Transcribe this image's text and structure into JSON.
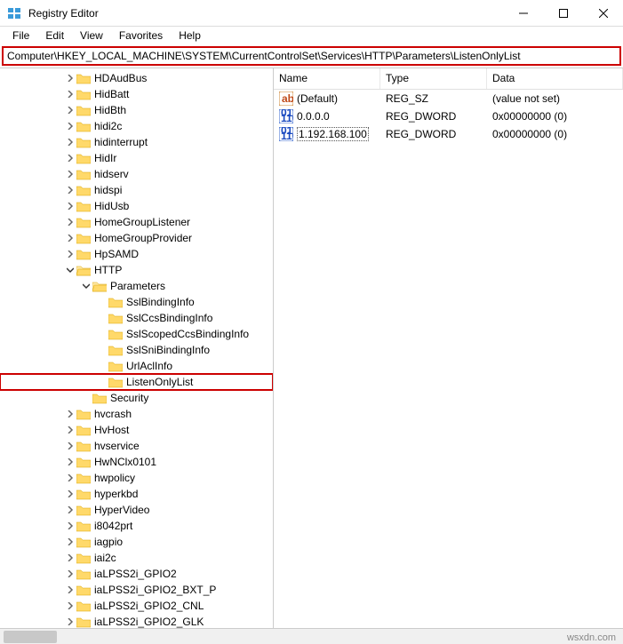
{
  "window": {
    "title": "Registry Editor"
  },
  "menu": {
    "file": "File",
    "edit": "Edit",
    "view": "View",
    "favorites": "Favorites",
    "help": "Help"
  },
  "address": "Computer\\HKEY_LOCAL_MACHINE\\SYSTEM\\CurrentControlSet\\Services\\HTTP\\Parameters\\ListenOnlyList",
  "tree": [
    {
      "indent": 4,
      "expander": "closed",
      "label": "HDAudBus"
    },
    {
      "indent": 4,
      "expander": "closed",
      "label": "HidBatt"
    },
    {
      "indent": 4,
      "expander": "closed",
      "label": "HidBth"
    },
    {
      "indent": 4,
      "expander": "closed",
      "label": "hidi2c"
    },
    {
      "indent": 4,
      "expander": "closed",
      "label": "hidinterrupt"
    },
    {
      "indent": 4,
      "expander": "closed",
      "label": "HidIr"
    },
    {
      "indent": 4,
      "expander": "closed",
      "label": "hidserv"
    },
    {
      "indent": 4,
      "expander": "closed",
      "label": "hidspi"
    },
    {
      "indent": 4,
      "expander": "closed",
      "label": "HidUsb"
    },
    {
      "indent": 4,
      "expander": "closed",
      "label": "HomeGroupListener"
    },
    {
      "indent": 4,
      "expander": "closed",
      "label": "HomeGroupProvider"
    },
    {
      "indent": 4,
      "expander": "closed",
      "label": "HpSAMD"
    },
    {
      "indent": 4,
      "expander": "open",
      "label": "HTTP"
    },
    {
      "indent": 5,
      "expander": "open",
      "label": "Parameters"
    },
    {
      "indent": 6,
      "expander": "none",
      "label": "SslBindingInfo"
    },
    {
      "indent": 6,
      "expander": "none",
      "label": "SslCcsBindingInfo"
    },
    {
      "indent": 6,
      "expander": "none",
      "label": "SslScopedCcsBindingInfo"
    },
    {
      "indent": 6,
      "expander": "none",
      "label": "SslSniBindingInfo"
    },
    {
      "indent": 6,
      "expander": "none",
      "label": "UrlAclInfo"
    },
    {
      "indent": 6,
      "expander": "none",
      "label": "ListenOnlyList",
      "highlight": true
    },
    {
      "indent": 5,
      "expander": "none",
      "label": "Security"
    },
    {
      "indent": 4,
      "expander": "closed",
      "label": "hvcrash"
    },
    {
      "indent": 4,
      "expander": "closed",
      "label": "HvHost"
    },
    {
      "indent": 4,
      "expander": "closed",
      "label": "hvservice"
    },
    {
      "indent": 4,
      "expander": "closed",
      "label": "HwNClx0101"
    },
    {
      "indent": 4,
      "expander": "closed",
      "label": "hwpolicy"
    },
    {
      "indent": 4,
      "expander": "closed",
      "label": "hyperkbd"
    },
    {
      "indent": 4,
      "expander": "closed",
      "label": "HyperVideo"
    },
    {
      "indent": 4,
      "expander": "closed",
      "label": "i8042prt"
    },
    {
      "indent": 4,
      "expander": "closed",
      "label": "iagpio"
    },
    {
      "indent": 4,
      "expander": "closed",
      "label": "iai2c"
    },
    {
      "indent": 4,
      "expander": "closed",
      "label": "iaLPSS2i_GPIO2"
    },
    {
      "indent": 4,
      "expander": "closed",
      "label": "iaLPSS2i_GPIO2_BXT_P"
    },
    {
      "indent": 4,
      "expander": "closed",
      "label": "iaLPSS2i_GPIO2_CNL"
    },
    {
      "indent": 4,
      "expander": "closed",
      "label": "iaLPSS2i_GPIO2_GLK"
    }
  ],
  "list": {
    "headers": {
      "name": "Name",
      "type": "Type",
      "data": "Data"
    },
    "rows": [
      {
        "icon": "string",
        "name": "(Default)",
        "type": "REG_SZ",
        "data": "(value not set)",
        "selected": false
      },
      {
        "icon": "binary",
        "name": "0.0.0.0",
        "type": "REG_DWORD",
        "data": "0x00000000 (0)",
        "selected": false
      },
      {
        "icon": "binary",
        "name": "1.192.168.100",
        "type": "REG_DWORD",
        "data": "0x00000000 (0)",
        "selected": true
      }
    ]
  },
  "footer": "wsxdn.com"
}
